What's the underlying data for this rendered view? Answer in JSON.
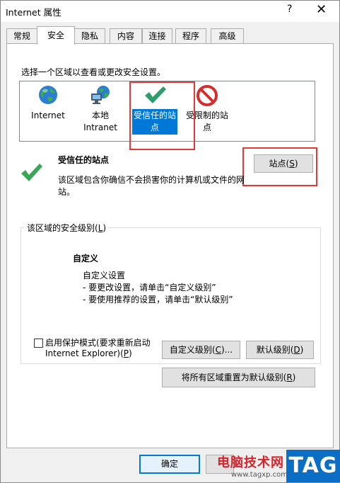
{
  "window": {
    "title": "Internet 属性",
    "help": "?",
    "close": "✕"
  },
  "tabs": [
    "常规",
    "安全",
    "隐私",
    "内容",
    "连接",
    "程序",
    "高级"
  ],
  "active_tab": "安全",
  "security": {
    "instruction": "选择一个区域以查看或更改安全设置。",
    "zones": [
      {
        "line1": "Internet",
        "line2": ""
      },
      {
        "line1": "本地",
        "line2": "Intranet"
      },
      {
        "line1": "受信任的站",
        "line2": "点"
      },
      {
        "line1": "受限制的站",
        "line2": "点"
      }
    ],
    "selected_zone": {
      "title": "受信任的站点",
      "desc_line1": "该区域包含你确信不会损害你的计算机或文件的网",
      "desc_line2": "站。"
    },
    "sites_button": {
      "label": "站点(",
      "mnemonic": "S",
      "suffix": ")"
    },
    "level_group": {
      "label": "该区域的安全级别(",
      "mnemonic": "L",
      "suffix": ")"
    },
    "custom": {
      "title": "自定义",
      "line1": "自定义设置",
      "line2": "- 要更改设置，请单击“自定义级别”",
      "line3": "- 要使用推荐的设置，请单击“默认级别”"
    },
    "protected_mode": {
      "line1": "启用保护模式(要求重新启动",
      "line2": "Internet Explorer)(",
      "mnemonic": "P",
      "suffix": ")",
      "checked": false
    },
    "custom_level_button": {
      "label": "自定义级别(",
      "mnemonic": "C",
      "suffix": ")..."
    },
    "default_level_button": {
      "label": "默认级别(",
      "mnemonic": "D",
      "suffix": ")"
    },
    "reset_all_button": {
      "label": "将所有区域重置为默认级别(",
      "mnemonic": "R",
      "suffix": ")"
    }
  },
  "footer": {
    "ok_label": "确定"
  },
  "watermark": {
    "text": "电脑技术网",
    "url": "www.tagxp.com",
    "tag": "TAG"
  },
  "colors": {
    "highlight_red": "#e53935",
    "selection_blue": "#0078d7",
    "check_green": "#3aa757"
  }
}
